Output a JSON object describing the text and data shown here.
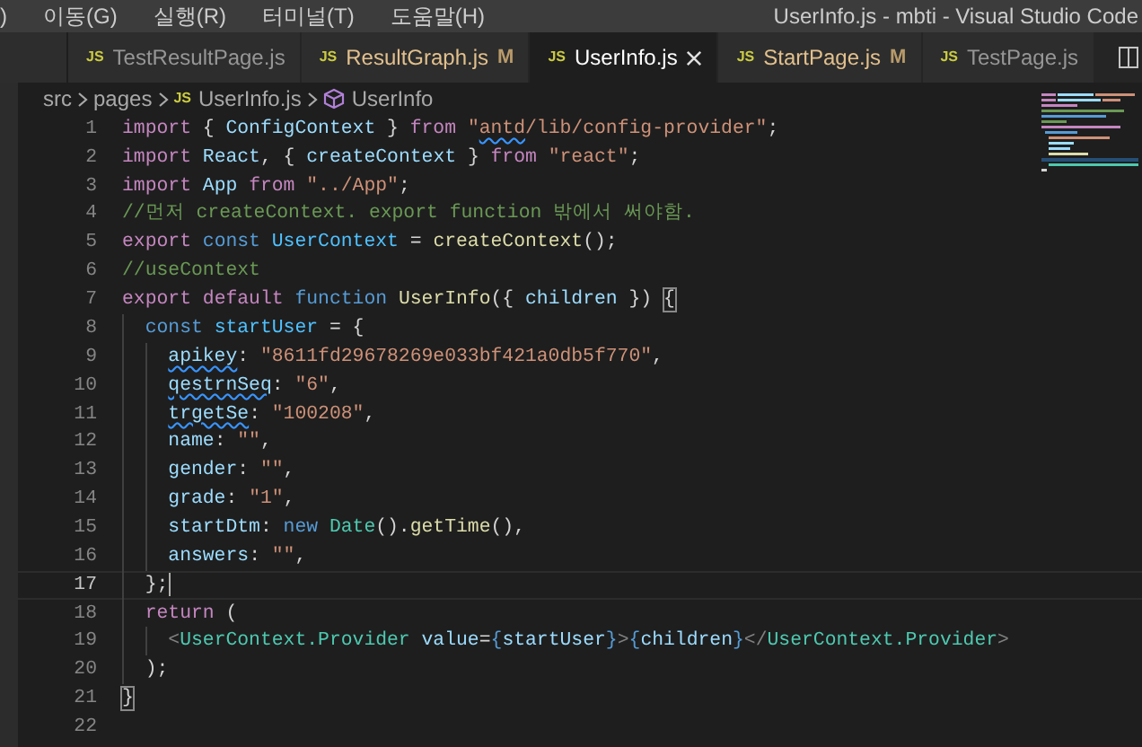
{
  "title_bar": {
    "menu": [
      ")",
      "이동(G)",
      "실행(R)",
      "터미널(T)",
      "도움말(H)"
    ],
    "title": "UserInfo.js - mbti - Visual Studio Code"
  },
  "tabs": [
    {
      "icon": "JS",
      "label": "TestResultPage.js",
      "modified": false,
      "selected": false
    },
    {
      "icon": "JS",
      "label": "ResultGraph.js",
      "modified": true,
      "badge": "M",
      "selected": false
    },
    {
      "icon": "JS",
      "label": "UserInfo.js",
      "modified": false,
      "selected": true
    },
    {
      "icon": "JS",
      "label": "StartPage.js",
      "modified": true,
      "badge": "M",
      "selected": false
    },
    {
      "icon": "JS",
      "label": "TestPage.js",
      "modified": false,
      "selected": false
    }
  ],
  "breadcrumbs": [
    {
      "kind": "folder",
      "label": "src"
    },
    {
      "kind": "folder",
      "label": "pages"
    },
    {
      "kind": "file",
      "icon": "JS",
      "label": "UserInfo.js"
    },
    {
      "kind": "symbol",
      "label": "UserInfo"
    }
  ],
  "lines": [
    {
      "number": "1",
      "current": false,
      "tokens": [
        {
          "text": "import ",
          "kind": "control"
        },
        {
          "text": "{ ",
          "kind": "punct"
        },
        {
          "text": "ConfigContext ",
          "kind": "variable"
        },
        {
          "text": "} ",
          "kind": "punct"
        },
        {
          "text": "from ",
          "kind": "control"
        },
        {
          "text": "\"",
          "kind": "string"
        },
        {
          "text": "antd",
          "kind": "string",
          "squiggle": true
        },
        {
          "text": "/lib/config-provider\"",
          "kind": "string"
        },
        {
          "text": ";",
          "kind": "punct"
        }
      ]
    },
    {
      "number": "2",
      "current": false,
      "tokens": [
        {
          "text": "import ",
          "kind": "control"
        },
        {
          "text": "React",
          "kind": "variable"
        },
        {
          "text": ", { ",
          "kind": "punct"
        },
        {
          "text": "createContext ",
          "kind": "variable"
        },
        {
          "text": "} ",
          "kind": "punct"
        },
        {
          "text": "from ",
          "kind": "control"
        },
        {
          "text": "\"react\"",
          "kind": "string"
        },
        {
          "text": ";",
          "kind": "punct"
        }
      ]
    },
    {
      "number": "3",
      "current": false,
      "tokens": [
        {
          "text": "import ",
          "kind": "control"
        },
        {
          "text": "App ",
          "kind": "variable"
        },
        {
          "text": "from ",
          "kind": "control"
        },
        {
          "text": "\"../App\"",
          "kind": "string"
        },
        {
          "text": ";",
          "kind": "punct"
        }
      ]
    },
    {
      "number": "4",
      "current": false,
      "tokens": [
        {
          "text": "//먼저 createContext. export function 밖에서 써야함.",
          "kind": "comment"
        }
      ]
    },
    {
      "number": "5",
      "current": false,
      "tokens": [
        {
          "text": "export ",
          "kind": "control"
        },
        {
          "text": "const ",
          "kind": "storage"
        },
        {
          "text": "UserContext ",
          "kind": "constant"
        },
        {
          "text": "= ",
          "kind": "punct"
        },
        {
          "text": "createContext",
          "kind": "function"
        },
        {
          "text": "();",
          "kind": "punct"
        }
      ]
    },
    {
      "number": "6",
      "current": false,
      "tokens": [
        {
          "text": "//useContext",
          "kind": "comment"
        }
      ]
    },
    {
      "number": "7",
      "current": false,
      "tokens": [
        {
          "text": "export ",
          "kind": "control"
        },
        {
          "text": "default ",
          "kind": "control"
        },
        {
          "text": "function ",
          "kind": "storage"
        },
        {
          "text": "UserInfo",
          "kind": "function"
        },
        {
          "text": "({ ",
          "kind": "punct"
        },
        {
          "text": "children ",
          "kind": "variable"
        },
        {
          "text": "}) ",
          "kind": "punct"
        },
        {
          "text": "{",
          "kind": "punct",
          "match": true
        }
      ],
      "children": [
        {
          "number": "8",
          "current": false,
          "tokens": [
            {
              "text": "const ",
              "kind": "storage"
            },
            {
              "text": "startUser ",
              "kind": "constant"
            },
            {
              "text": "= {",
              "kind": "punct"
            }
          ],
          "children": [
            {
              "number": "9",
              "current": false,
              "tokens": [
                {
                  "text": "apikey",
                  "kind": "variable",
                  "squiggle": true
                },
                {
                  "text": ": ",
                  "kind": "punct"
                },
                {
                  "text": "\"8611fd29678269e033bf421a0db5f770\"",
                  "kind": "string"
                },
                {
                  "text": ",",
                  "kind": "punct"
                }
              ]
            },
            {
              "number": "10",
              "current": false,
              "tokens": [
                {
                  "text": "qestrnSeq",
                  "kind": "variable",
                  "squiggle": true
                },
                {
                  "text": ": ",
                  "kind": "punct"
                },
                {
                  "text": "\"6\"",
                  "kind": "string"
                },
                {
                  "text": ",",
                  "kind": "punct"
                }
              ]
            },
            {
              "number": "11",
              "current": false,
              "tokens": [
                {
                  "text": "trgetSe",
                  "kind": "variable",
                  "squiggle": true
                },
                {
                  "text": ": ",
                  "kind": "punct"
                },
                {
                  "text": "\"100208\"",
                  "kind": "string"
                },
                {
                  "text": ",",
                  "kind": "punct"
                }
              ]
            },
            {
              "number": "12",
              "current": false,
              "tokens": [
                {
                  "text": "name",
                  "kind": "variable"
                },
                {
                  "text": ": ",
                  "kind": "punct"
                },
                {
                  "text": "\"\"",
                  "kind": "string"
                },
                {
                  "text": ",",
                  "kind": "punct"
                }
              ]
            },
            {
              "number": "13",
              "current": false,
              "tokens": [
                {
                  "text": "gender",
                  "kind": "variable"
                },
                {
                  "text": ": ",
                  "kind": "punct"
                },
                {
                  "text": "\"\"",
                  "kind": "string"
                },
                {
                  "text": ",",
                  "kind": "punct"
                }
              ]
            },
            {
              "number": "14",
              "current": false,
              "tokens": [
                {
                  "text": "grade",
                  "kind": "variable"
                },
                {
                  "text": ": ",
                  "kind": "punct"
                },
                {
                  "text": "\"1\"",
                  "kind": "string"
                },
                {
                  "text": ",",
                  "kind": "punct"
                }
              ]
            },
            {
              "number": "15",
              "current": false,
              "tokens": [
                {
                  "text": "startDtm",
                  "kind": "variable"
                },
                {
                  "text": ": ",
                  "kind": "punct"
                },
                {
                  "text": "new ",
                  "kind": "storage"
                },
                {
                  "text": "Date",
                  "kind": "type"
                },
                {
                  "text": "().",
                  "kind": "punct"
                },
                {
                  "text": "getTime",
                  "kind": "function"
                },
                {
                  "text": "(),",
                  "kind": "punct"
                }
              ]
            },
            {
              "number": "16",
              "current": false,
              "tokens": [
                {
                  "text": "answers",
                  "kind": "variable"
                },
                {
                  "text": ": ",
                  "kind": "punct"
                },
                {
                  "text": "\"\"",
                  "kind": "string"
                },
                {
                  "text": ",",
                  "kind": "punct"
                }
              ]
            }
          ]
        },
        {
          "number": "17",
          "current": true,
          "tokens": [
            {
              "text": "};",
              "kind": "punct"
            }
          ]
        },
        {
          "number": "18",
          "current": false,
          "tokens": [
            {
              "text": "return ",
              "kind": "control"
            },
            {
              "text": "(",
              "kind": "punct"
            }
          ],
          "children": [
            {
              "number": "19",
              "current": false,
              "tokens": [
                {
                  "text": "<",
                  "kind": "tagpunct"
                },
                {
                  "text": "UserContext.Provider ",
                  "kind": "type"
                },
                {
                  "text": "value",
                  "kind": "variable"
                },
                {
                  "text": "=",
                  "kind": "punct"
                },
                {
                  "text": "{",
                  "kind": "storage"
                },
                {
                  "text": "startUser",
                  "kind": "variable"
                },
                {
                  "text": "}",
                  "kind": "storage"
                },
                {
                  "text": ">",
                  "kind": "tagpunct"
                },
                {
                  "text": "{",
                  "kind": "storage"
                },
                {
                  "text": "children",
                  "kind": "variable"
                },
                {
                  "text": "}",
                  "kind": "storage"
                },
                {
                  "text": "</",
                  "kind": "tagpunct"
                },
                {
                  "text": "UserContext.Provider",
                  "kind": "type"
                },
                {
                  "text": ">",
                  "kind": "tagpunct"
                }
              ]
            }
          ]
        },
        {
          "number": "20",
          "current": false,
          "tokens": [
            {
              "text": ");",
              "kind": "punct"
            }
          ]
        }
      ]
    },
    {
      "number": "21",
      "current": false,
      "tokens": [
        {
          "text": "}",
          "kind": "punct",
          "match": true
        }
      ]
    },
    {
      "number": "22",
      "current": false
    }
  ]
}
